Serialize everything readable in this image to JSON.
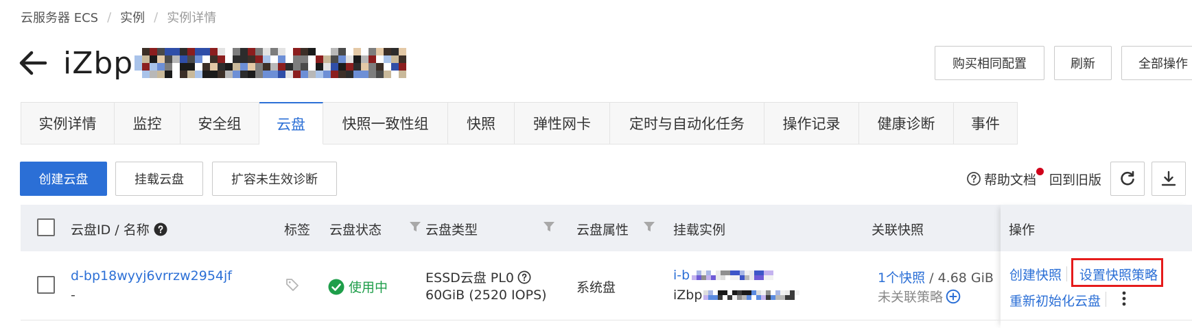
{
  "breadcrumb": {
    "items": [
      "云服务器 ECS",
      "实例",
      "实例详情"
    ],
    "separator": "/"
  },
  "title": {
    "prefix": "iZbp",
    "masked": true
  },
  "header_actions": {
    "buy_same": "购买相同配置",
    "refresh": "刷新",
    "all_actions": "全部操作"
  },
  "tabs": [
    {
      "label": "实例详情",
      "active": false
    },
    {
      "label": "监控",
      "active": false
    },
    {
      "label": "安全组",
      "active": false
    },
    {
      "label": "云盘",
      "active": true
    },
    {
      "label": "快照一致性组",
      "active": false
    },
    {
      "label": "快照",
      "active": false
    },
    {
      "label": "弹性网卡",
      "active": false
    },
    {
      "label": "定时与自动化任务",
      "active": false
    },
    {
      "label": "操作记录",
      "active": false
    },
    {
      "label": "健康诊断",
      "active": false
    },
    {
      "label": "事件",
      "active": false
    }
  ],
  "toolbar": {
    "create_disk": "创建云盘",
    "attach_disk": "挂载云盘",
    "expand_diagnose": "扩容未生效诊断",
    "help_doc": "帮助文档",
    "back_old": "回到旧版"
  },
  "table": {
    "headers": {
      "disk_id": "云盘ID / 名称",
      "tags": "标签",
      "status": "云盘状态",
      "type": "云盘类型",
      "attr": "云盘属性",
      "instance": "挂载实例",
      "snapshot": "关联快照",
      "ops": "操作"
    },
    "rows": [
      {
        "disk_id": "d-bp18wyyj6vrrzw2954jf",
        "name": "-",
        "status": "使用中",
        "type_line1": "ESSD云盘 PL0",
        "type_line2": "60GiB (2520 IOPS)",
        "attr": "系统盘",
        "instance_id_prefix": "i-b",
        "instance_name_prefix": "iZbp",
        "snapshot_count": "1个快照",
        "snapshot_size": " / 4.68 GiB",
        "policy_status": "未关联策略",
        "ops": {
          "create_snapshot": "创建快照",
          "set_policy": "设置快照策略",
          "reinit": "重新初始化云盘"
        }
      }
    ]
  },
  "colors": {
    "primary": "#2b6fd6",
    "success": "#1e9e4a",
    "highlight": "#e51b1b",
    "notify_dot": "#d0021b"
  },
  "icons": [
    "back-arrow-icon",
    "help-circle-icon",
    "refresh-icon",
    "download-icon",
    "filter-icon",
    "tag-icon",
    "check-circle-icon",
    "plus-circle-icon",
    "more-vertical-icon"
  ]
}
